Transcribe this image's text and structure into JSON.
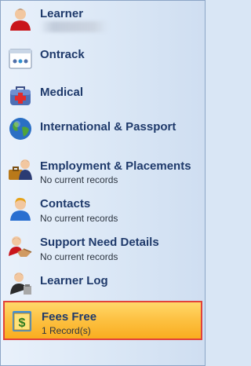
{
  "nav": {
    "items": [
      {
        "key": "learner",
        "title": "Learner",
        "subtitle": "",
        "icon": "learner-person-icon"
      },
      {
        "key": "ontrack",
        "title": "Ontrack",
        "subtitle": "",
        "icon": "ontrack-icon"
      },
      {
        "key": "medical",
        "title": "Medical",
        "subtitle": "",
        "icon": "medical-bag-icon"
      },
      {
        "key": "international",
        "title": "International & Passport",
        "subtitle": "",
        "icon": "globe-icon"
      },
      {
        "key": "employment",
        "title": "Employment & Placements",
        "subtitle": "No current records",
        "icon": "briefcase-person-icon"
      },
      {
        "key": "contacts",
        "title": "Contacts",
        "subtitle": "No current records",
        "icon": "contact-person-icon"
      },
      {
        "key": "support",
        "title": "Support Need Details",
        "subtitle": "No current records",
        "icon": "support-handshake-icon"
      },
      {
        "key": "log",
        "title": "Learner Log",
        "subtitle": "",
        "icon": "learner-log-icon"
      },
      {
        "key": "fees",
        "title": "Fees Free",
        "subtitle": "1 Record(s)",
        "icon": "fees-dollar-icon",
        "selected": true
      }
    ]
  },
  "colors": {
    "title_text": "#1f3a6b",
    "selected_bg": "#fdc244",
    "selected_border": "#e2423a",
    "panel_bg": "#d9e6f5"
  }
}
